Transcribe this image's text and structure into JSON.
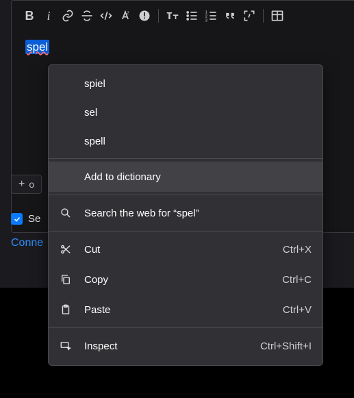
{
  "editor": {
    "text": "spel"
  },
  "add_button": {
    "label": "o"
  },
  "checkbox": {
    "label": "Se"
  },
  "link": {
    "label": "Conne"
  },
  "context_menu": {
    "suggestions": [
      {
        "label": "spiel"
      },
      {
        "label": "sel"
      },
      {
        "label": "spell"
      }
    ],
    "add_to_dictionary": "Add to dictionary",
    "search_web": "Search the web for “spel”",
    "cut": {
      "label": "Cut",
      "shortcut": "Ctrl+X"
    },
    "copy": {
      "label": "Copy",
      "shortcut": "Ctrl+C"
    },
    "paste": {
      "label": "Paste",
      "shortcut": "Ctrl+V"
    },
    "inspect": {
      "label": "Inspect",
      "shortcut": "Ctrl+Shift+I"
    }
  }
}
